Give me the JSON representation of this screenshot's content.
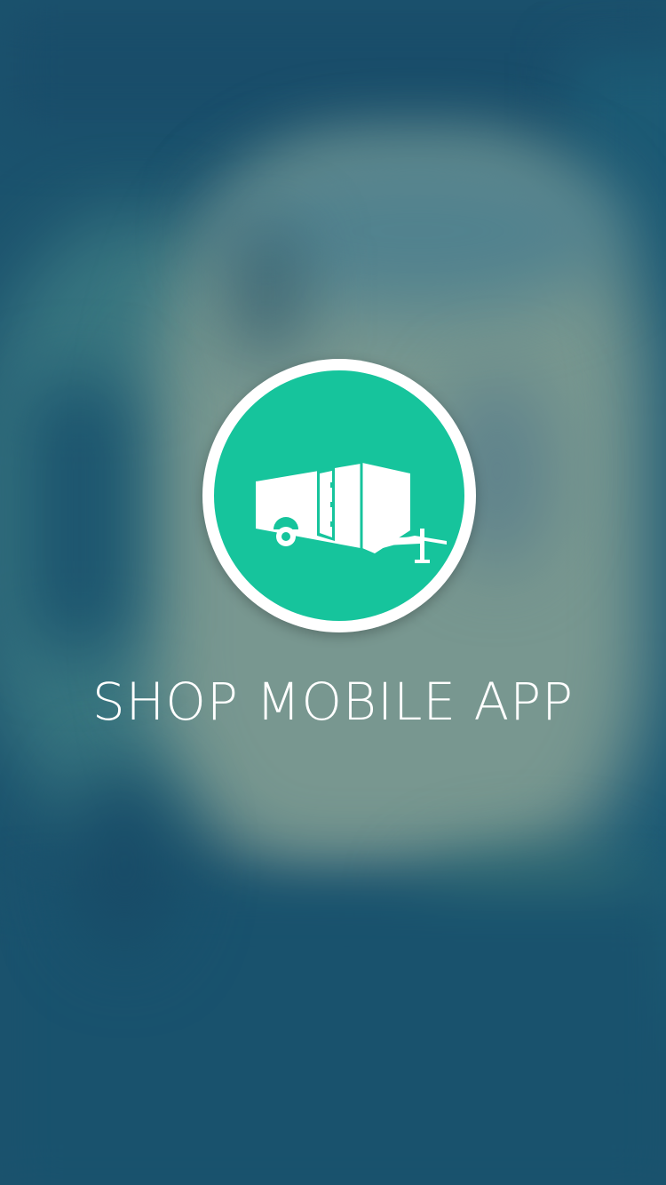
{
  "splash": {
    "title": "SHOP MOBILE APP",
    "logo_icon": "trailer-icon"
  },
  "colors": {
    "accent": "#16c49c",
    "background": "#1d5670",
    "text": "#ffffff"
  }
}
